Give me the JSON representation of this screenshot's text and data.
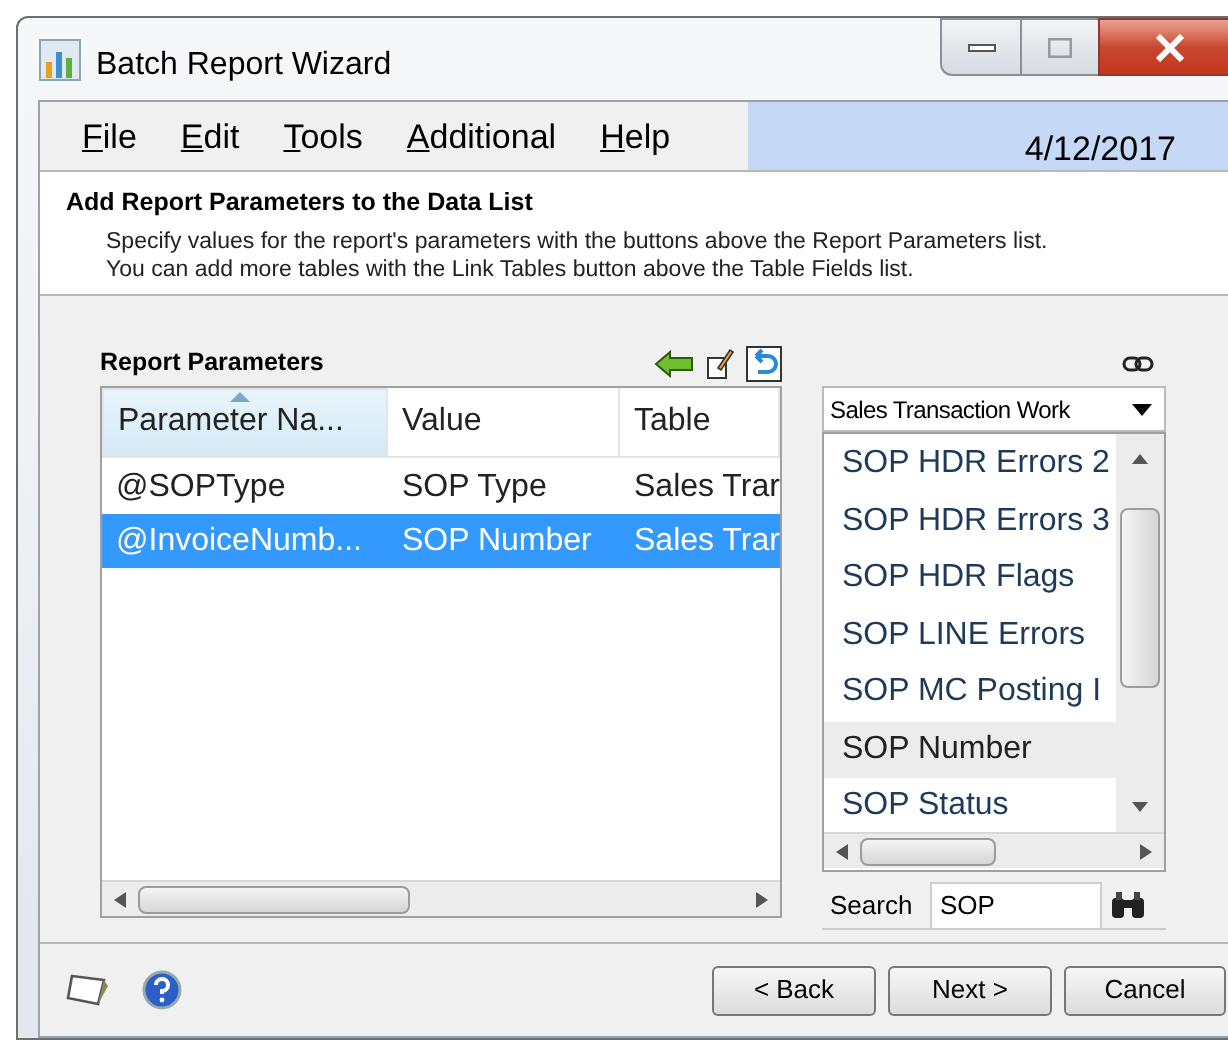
{
  "window": {
    "title": "Batch Report Wizard"
  },
  "menu": [
    {
      "label": "File"
    },
    {
      "label": "Edit"
    },
    {
      "label": "Tools"
    },
    {
      "label": "Additional"
    },
    {
      "label": "Help"
    }
  ],
  "date": "4/12/2017",
  "header": {
    "title": "Add Report Parameters to the Data List",
    "lines": [
      "Specify values for the report's parameters with the buttons above the Report Parameters list.",
      "You can add more tables with the Link Tables button above the Table Fields list."
    ]
  },
  "parameters": {
    "title": "Report Parameters",
    "columns": [
      "Parameter Na...",
      "Value",
      "Table"
    ],
    "rows": [
      {
        "cells": [
          "@SOPType",
          "SOP Type",
          "Sales Trar"
        ],
        "selected": false
      },
      {
        "cells": [
          "@InvoiceNumb...",
          "SOP Number",
          "Sales Trar"
        ],
        "selected": true
      }
    ]
  },
  "table_fields": {
    "dropdown": "Sales Transaction Work",
    "items": [
      {
        "label": "SOP HDR Errors 2",
        "selected": false
      },
      {
        "label": "SOP HDR Errors 3",
        "selected": false
      },
      {
        "label": "SOP HDR Flags",
        "selected": false
      },
      {
        "label": "SOP LINE Errors",
        "selected": false
      },
      {
        "label": "SOP MC Posting I",
        "selected": false
      },
      {
        "label": "SOP Number",
        "selected": true
      },
      {
        "label": "SOP Status",
        "selected": false
      }
    ],
    "search_label": "Search",
    "search_value": "SOP"
  },
  "buttons": [
    "< Back",
    "Next >",
    "Cancel"
  ]
}
